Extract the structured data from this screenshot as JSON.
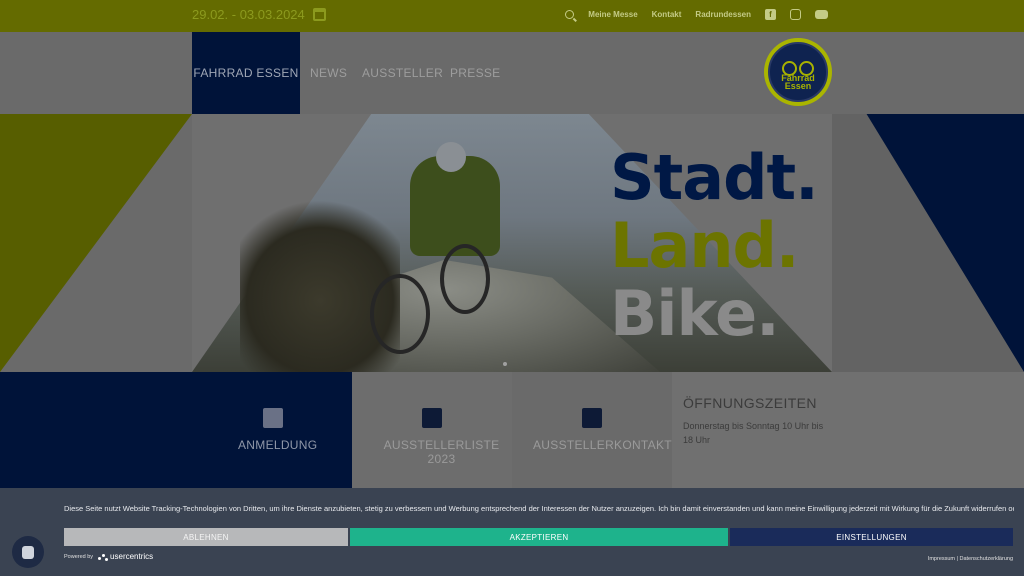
{
  "topbar": {
    "date": "29.02. - 03.03.2024",
    "links": [
      "Meine Messe",
      "Kontakt",
      "Radrundessen"
    ],
    "social": [
      "facebook-icon",
      "instagram-icon",
      "youtube-icon"
    ]
  },
  "nav": {
    "items": [
      "FAHRRAD ESSEN",
      "NEWS",
      "AUSSTELLER",
      "PRESSE"
    ],
    "logo": [
      "Fahrrad",
      "Essen"
    ]
  },
  "hero": {
    "lines": [
      "Stadt.",
      "Land.",
      "Bike."
    ]
  },
  "tiles": {
    "items": [
      "ANMELDUNG",
      "AUSSTELLERLISTE 2023",
      "AUSSTELLERKONTAKT"
    ],
    "hours_title": "ÖFFNUNGSZEITEN",
    "hours_text": "Donnerstag bis Sonntag 10 Uhr bis 18 Uhr"
  },
  "cookie": {
    "text": "Diese Seite nutzt Website Tracking-Technologien von Dritten, um ihre Dienste anzubieten, stetig zu verbessern und Werbung entsprechend der Interessen der Nutzer anzuzeigen. Ich bin damit einverstanden und kann meine Einwilligung jederzeit mit Wirkung für die Zukunft widerrufen oder ändern.",
    "deny": "ABLEHNEN",
    "accept": "AKZEPTIEREN",
    "settings": "EINSTELLUNGEN",
    "powered_by": "Powered by",
    "brand": "usercentrics",
    "footer": "Impressum | Datenschutzerklärung"
  },
  "colors": {
    "accent_green": "#aab500",
    "navy": "#001339",
    "accept_green": "#1eb38c"
  }
}
